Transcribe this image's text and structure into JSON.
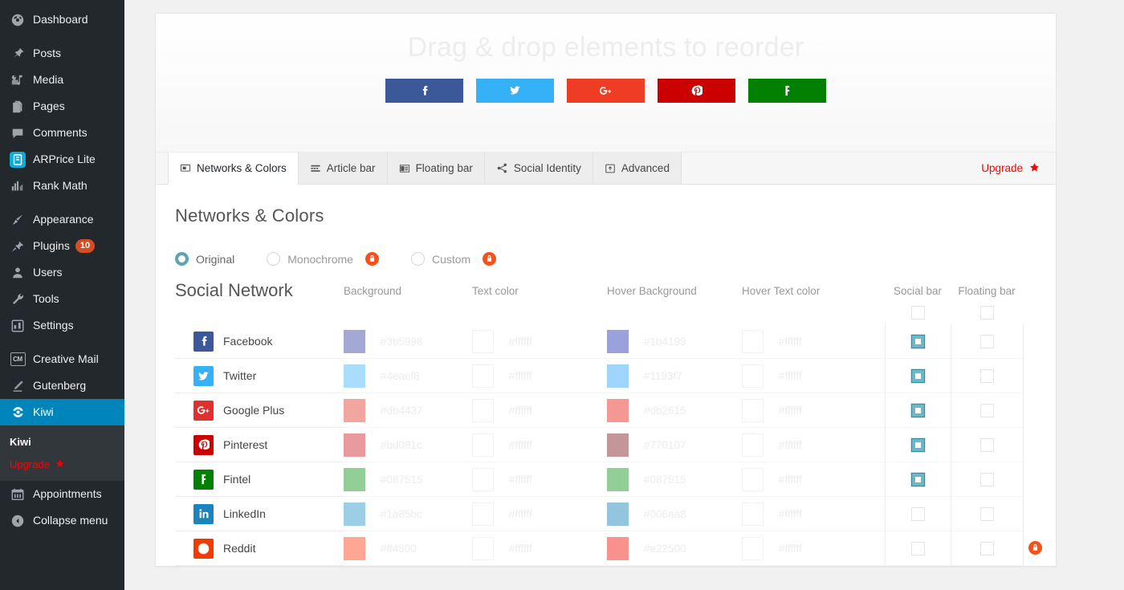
{
  "sidebar": {
    "items": [
      {
        "label": "Dashboard",
        "icon": "dashboard-icon"
      },
      {
        "label": "Posts",
        "icon": "pin-icon"
      },
      {
        "label": "Media",
        "icon": "media-icon"
      },
      {
        "label": "Pages",
        "icon": "pages-icon"
      },
      {
        "label": "Comments",
        "icon": "comments-icon"
      },
      {
        "label": "ARPrice Lite",
        "icon": "arprice-icon"
      },
      {
        "label": "Rank Math",
        "icon": "rankmath-icon"
      },
      {
        "label": "Appearance",
        "icon": "brush-icon"
      },
      {
        "label": "Plugins",
        "icon": "plug-icon",
        "badge": "10"
      },
      {
        "label": "Users",
        "icon": "users-icon"
      },
      {
        "label": "Tools",
        "icon": "wrench-icon"
      },
      {
        "label": "Settings",
        "icon": "settings-icon"
      },
      {
        "label": "Creative Mail",
        "icon": "creative-mail-icon"
      },
      {
        "label": "Gutenberg",
        "icon": "pencil-icon"
      },
      {
        "label": "Kiwi",
        "icon": "kiwi-icon",
        "active": true
      },
      {
        "label": "Appointments",
        "icon": "calendar-icon"
      },
      {
        "label": "Collapse menu",
        "icon": "collapse-icon"
      }
    ],
    "submenu": {
      "current": "Kiwi",
      "upgrade": "Upgrade"
    }
  },
  "preview": {
    "title": "Drag & drop elements to reorder",
    "buttons": [
      {
        "name": "Facebook",
        "icon": "facebook-icon",
        "color": "#3b5998"
      },
      {
        "name": "Twitter",
        "icon": "twitter-icon",
        "color": "#35b1f7"
      },
      {
        "name": "Google Plus",
        "icon": "google-plus-icon",
        "color": "#ef3c25"
      },
      {
        "name": "Pinterest",
        "icon": "pinterest-icon",
        "color": "#cb0000"
      },
      {
        "name": "Fintel",
        "icon": "fintel-icon",
        "color": "#018001"
      }
    ]
  },
  "tabs": [
    {
      "label": "Networks & Colors",
      "icon": "networks-icon",
      "active": true
    },
    {
      "label": "Article bar",
      "icon": "article-bar-icon",
      "active": false
    },
    {
      "label": "Floating bar",
      "icon": "floating-bar-icon",
      "active": false
    },
    {
      "label": "Social Identity",
      "icon": "share-icon",
      "active": false
    },
    {
      "label": "Advanced",
      "icon": "advanced-icon",
      "active": false
    }
  ],
  "upgrade_link": {
    "label": "Upgrade",
    "icon": "star-icon"
  },
  "main": {
    "section_title": "Networks & Colors",
    "color_mode": {
      "options": [
        {
          "label": "Original",
          "selected": true,
          "locked": false
        },
        {
          "label": "Monochrome",
          "selected": false,
          "locked": true
        },
        {
          "label": "Custom",
          "selected": false,
          "locked": true
        }
      ]
    },
    "table": {
      "headers": {
        "network": "Social Network",
        "background": "Background",
        "text_color": "Text color",
        "hover_background": "Hover Background",
        "hover_text_color": "Hover Text color",
        "social_bar": "Social bar",
        "floating_bar": "Floating bar"
      },
      "header_social_bar_checked": false,
      "header_floating_bar_checked": false,
      "rows": [
        {
          "network": "Facebook",
          "icon": "facebook-icon",
          "icon_bg": "#3b5998",
          "background": "#3b5998",
          "swatch_bg": "#a3a8d4",
          "text_color": "#ffffff",
          "hover_background": "#1b4199",
          "swatch_hover": "#9ba1da",
          "hover_text_color": "#ffffff",
          "social_bar": true,
          "floating_bar": false,
          "locked": false
        },
        {
          "network": "Twitter",
          "icon": "twitter-icon",
          "icon_bg": "#35b1f7",
          "background": "#4eaef8",
          "swatch_bg": "#aadcfb",
          "text_color": "#ffffff",
          "hover_background": "#1193f7",
          "swatch_hover": "#9fd4fd",
          "hover_text_color": "#ffffff",
          "social_bar": true,
          "floating_bar": false,
          "locked": false
        },
        {
          "network": "Google Plus",
          "icon": "google-plus-icon",
          "icon_bg": "#e02f2f",
          "background": "#db4437",
          "swatch_bg": "#f1a69f",
          "text_color": "#ffffff",
          "hover_background": "#db2615",
          "swatch_hover": "#f59793",
          "hover_text_color": "#ffffff",
          "social_bar": true,
          "floating_bar": false,
          "locked": false
        },
        {
          "network": "Pinterest",
          "icon": "pinterest-icon",
          "icon_bg": "#cb0000",
          "background": "#bd081c",
          "swatch_bg": "#e89a9f",
          "text_color": "#ffffff",
          "hover_background": "#770107",
          "swatch_hover": "#c39799",
          "hover_text_color": "#ffffff",
          "social_bar": true,
          "floating_bar": false,
          "locked": false
        },
        {
          "network": "Fintel",
          "icon": "fintel-icon",
          "icon_bg": "#018001",
          "background": "#087515",
          "swatch_bg": "#92cf97",
          "text_color": "#ffffff",
          "hover_background": "#087515",
          "swatch_hover": "#92cf97",
          "hover_text_color": "#ffffff",
          "social_bar": true,
          "floating_bar": false,
          "locked": false
        },
        {
          "network": "LinkedIn",
          "icon": "linkedin-icon",
          "icon_bg": "#1a85bc",
          "background": "#1a85bc",
          "swatch_bg": "#9ccfe5",
          "text_color": "#ffffff",
          "hover_background": "#006aa8",
          "swatch_hover": "#93c6de",
          "hover_text_color": "#ffffff",
          "social_bar": false,
          "floating_bar": false,
          "locked": false
        },
        {
          "network": "Reddit",
          "icon": "reddit-icon",
          "icon_bg": "#f03c00",
          "background": "#ff4500",
          "swatch_bg": "#ffa793",
          "text_color": "#ffffff",
          "hover_background": "#e22500",
          "swatch_hover": "#f9928c",
          "hover_text_color": "#ffffff",
          "social_bar": false,
          "floating_bar": false,
          "locked": true
        }
      ]
    }
  },
  "colors": {
    "sidebar_bg": "#23282d",
    "sidebar_active": "#0085ba",
    "submenu_bg": "#32373c",
    "upgrade_red": "#ff0000",
    "lock_orange": "#f4511e",
    "checkbox_teal": "#6cb7c8",
    "page_bg": "#f1f1f1"
  }
}
